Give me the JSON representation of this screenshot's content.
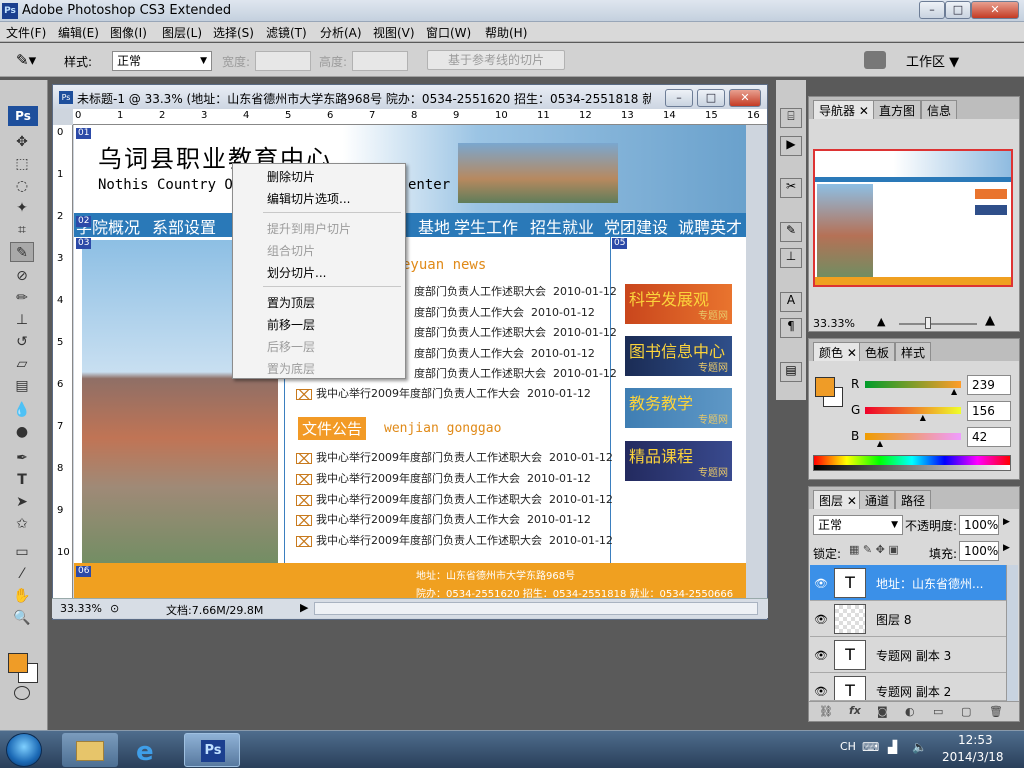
{
  "app": {
    "title": "Adobe Photoshop CS3 Extended",
    "logo": "Ps",
    "window_buttons": [
      "–",
      "□",
      "✕"
    ]
  },
  "menu": [
    "文件(F)",
    "编辑(E)",
    "图像(I)",
    "图层(L)",
    "选择(S)",
    "滤镜(T)",
    "分析(A)",
    "视图(V)",
    "窗口(W)",
    "帮助(H)"
  ],
  "options": {
    "style_label": "样式:",
    "style_value": "正常",
    "width_label": "宽度:",
    "height_label": "高度:",
    "slice_guides_button": "基于参考线的切片",
    "workspace_label": "工作区"
  },
  "toolbox": {
    "ps_badge": "Ps",
    "icons": [
      "move-tool-icon",
      "marquee-tool-icon",
      "lasso-tool-icon",
      "magic-wand-icon",
      "crop-tool-icon",
      "slice-select-tool-icon",
      "healing-brush-icon",
      "brush-icon",
      "clone-stamp-icon",
      "history-brush-icon",
      "eraser-icon",
      "gradient-icon",
      "blur-icon",
      "dodge-icon",
      "pen-icon",
      "type-icon",
      "path-select-icon",
      "shape-icon",
      "notes-icon",
      "eyedropper-icon",
      "hand-icon",
      "zoom-icon"
    ],
    "foreground_color": "#ef9c27",
    "background_color": "#ffffff"
  },
  "document": {
    "title": "未标题-1 @ 33.3% (地址：山东省德州市大学东路968号 院办：0534-2551620 招生：0534-2551818 就...",
    "ruler_h": [
      "0",
      "1",
      "2",
      "3",
      "4",
      "5",
      "6",
      "7",
      "8",
      "9",
      "10",
      "11",
      "12",
      "13",
      "14",
      "15",
      "16"
    ],
    "ruler_v": [
      "0",
      "1",
      "2",
      "3",
      "4",
      "5",
      "6",
      "7",
      "8",
      "9",
      "10"
    ],
    "zoom": "33.33%",
    "doc_size": "文档:7.66M/29.8M"
  },
  "page": {
    "school_name": "乌词县职业教育中心",
    "school_name_en": "Nothis Country O",
    "school_name_en_tail": "enter",
    "nav": [
      "学院概况",
      "系部设置",
      "基地",
      "学生工作",
      "招生就业",
      "党团建设",
      "诚聘英才"
    ],
    "news_heading_tail": "eyuan news",
    "news_items": [
      {
        "text": "度部门负责人工作述职大会",
        "date": "2010-01-12"
      },
      {
        "text": "度部门负责人工作大会",
        "date": "2010-01-12"
      },
      {
        "text": "度部门负责人工作述职大会",
        "date": "2010-01-12"
      },
      {
        "text": "度部门负责人工作大会",
        "date": "2010-01-12"
      },
      {
        "text": "度部门负责人工作述职大会",
        "date": "2010-01-12"
      },
      {
        "text": "我中心举行2009年度部门负责人工作大会",
        "date": "2010-01-12"
      }
    ],
    "notice_label": "文件公告",
    "notice_pinyin": "wenjian gonggao",
    "notice_items": [
      {
        "text": "我中心举行2009年度部门负责人工作述职大会",
        "date": "2010-01-12"
      },
      {
        "text": "我中心举行2009年度部门负责人工作大会",
        "date": "2010-01-12"
      },
      {
        "text": "我中心举行2009年度部门负责人工作述职大会",
        "date": "2010-01-12"
      },
      {
        "text": "我中心举行2009年度部门负责人工作大会",
        "date": "2010-01-12"
      },
      {
        "text": "我中心举行2009年度部门负责人工作述职大会",
        "date": "2010-01-12"
      }
    ],
    "banners": [
      {
        "title": "科学发展观",
        "sub": "专题网"
      },
      {
        "title": "图书信息中心",
        "sub": "专题网"
      },
      {
        "title": "教务教学",
        "sub": "专题网"
      },
      {
        "title": "精品课程",
        "sub": "专题网"
      }
    ],
    "footer_line1": "地址：山东省德州市大学东路968号",
    "footer_line2": "院办：0534-2551620 招生：0534-2551818 就业：0534-2550666",
    "slice_tags": [
      "01",
      "02",
      "03",
      "05",
      "06"
    ]
  },
  "context_menu": [
    {
      "label": "删除切片",
      "enabled": true
    },
    {
      "label": "编辑切片选项...",
      "enabled": true
    },
    {
      "label": "提升到用户切片",
      "enabled": false
    },
    {
      "label": "组合切片",
      "enabled": false
    },
    {
      "label": "划分切片...",
      "enabled": true
    },
    {
      "label": "置为顶层",
      "enabled": true
    },
    {
      "label": "前移一层",
      "enabled": true
    },
    {
      "label": "后移一层",
      "enabled": false
    },
    {
      "label": "置为底层",
      "enabled": false
    }
  ],
  "navigator": {
    "tabs": [
      "导航器",
      "直方图",
      "信息"
    ],
    "zoom": "33.33%"
  },
  "color_panel": {
    "tabs": [
      "颜色",
      "色板",
      "样式"
    ],
    "r_label": "R",
    "r_value": "239",
    "g_label": "G",
    "g_value": "156",
    "b_label": "B",
    "b_value": "42",
    "r_fraction": 0.937,
    "g_fraction": 0.612,
    "b_fraction": 0.165
  },
  "layers_panel": {
    "tabs": [
      "图层",
      "通道",
      "路径"
    ],
    "blend_mode": "正常",
    "opacity_label": "不透明度:",
    "opacity_value": "100%",
    "lock_label": "锁定:",
    "fill_label": "填充:",
    "fill_value": "100%",
    "layers": [
      {
        "name": "地址：山东省德州...",
        "thumb": "T",
        "selected": true
      },
      {
        "name": "图层 8",
        "thumb": "",
        "selected": false
      },
      {
        "name": "专题网 副本 3",
        "thumb": "T",
        "selected": false
      },
      {
        "name": "专题网 副本 2",
        "thumb": "T",
        "selected": false
      }
    ],
    "footer_icons": [
      "link-icon",
      "fx-icon",
      "mask-icon",
      "adjustment-icon",
      "folder-icon",
      "new-layer-icon",
      "trash-icon"
    ]
  },
  "taskbar": {
    "apps": [
      "explorer-icon",
      "ie-icon",
      "photoshop-icon"
    ],
    "ps_label": "Ps",
    "ime": "CH",
    "time": "12:53",
    "date": "2014/3/18"
  }
}
